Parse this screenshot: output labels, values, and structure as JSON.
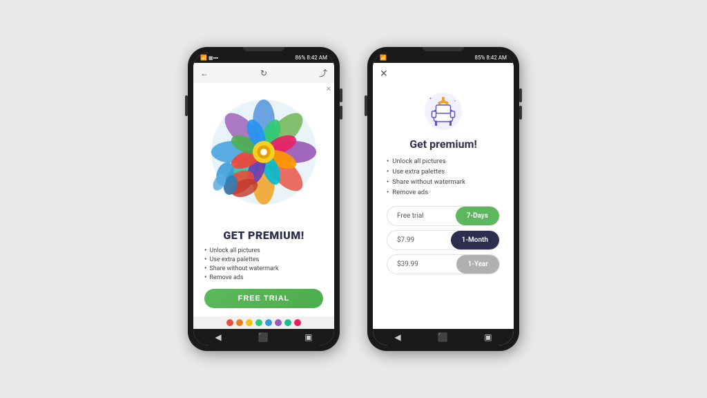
{
  "phone1": {
    "status": {
      "time": "8:42 AM",
      "battery": "86%",
      "signal": "4G"
    },
    "header": {
      "back_icon": "←",
      "refresh_icon": "↻",
      "share_icon": "⤴"
    },
    "premium_title": "GET PREMIUM!",
    "features": [
      "Unlock all pictures",
      "Use extra palettes",
      "Share without watermark",
      "Remove ads"
    ],
    "cta_button": "FREE TRIAL"
  },
  "phone2": {
    "status": {
      "time": "8:42 AM",
      "battery": "85%"
    },
    "close_icon": "✕",
    "heading": "Get premium!",
    "features": [
      "Unlock all pictures",
      "Use extra palettes",
      "Share without watermark",
      "Remove ads"
    ],
    "pricing": [
      {
        "label": "Free trial",
        "period": "7-Days",
        "style": "green"
      },
      {
        "label": "$7.99",
        "period": "1-Month",
        "style": "dark"
      },
      {
        "label": "$39.99",
        "period": "1-Year",
        "style": "gray"
      }
    ]
  },
  "nav": {
    "back": "◀",
    "home": "⬛",
    "recent": "▣"
  }
}
